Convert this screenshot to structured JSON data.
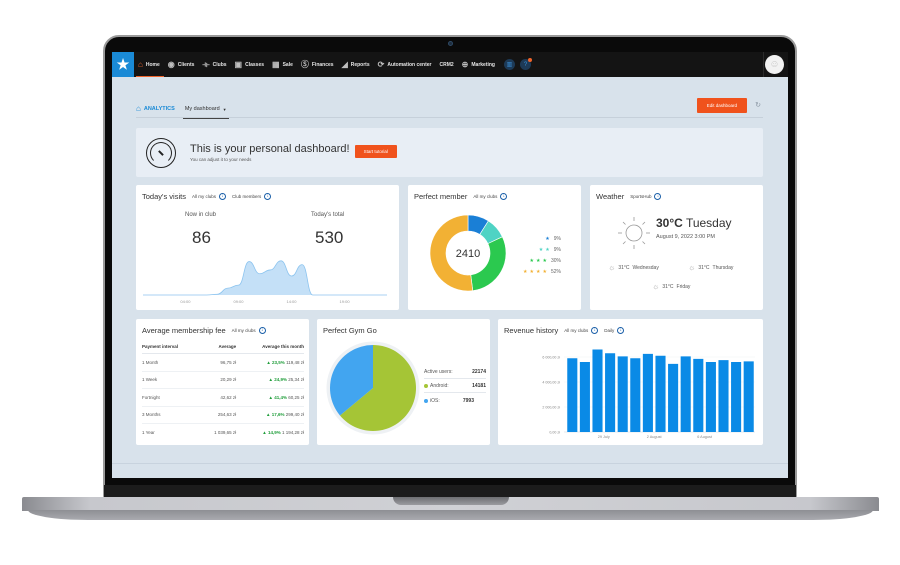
{
  "nav": {
    "logo": "logo-star",
    "items": [
      {
        "label": "Home",
        "icon": "home-icon",
        "glyph": "⌂",
        "active": true
      },
      {
        "label": "Clients",
        "icon": "user-circle-icon",
        "glyph": "◉"
      },
      {
        "label": "Clubs",
        "icon": "dumbbell-icon",
        "glyph": "⟛"
      },
      {
        "label": "Classes",
        "icon": "calendar-clock-icon",
        "glyph": "▣"
      },
      {
        "label": "Sale",
        "icon": "grid-icon",
        "glyph": "▦"
      },
      {
        "label": "Finances",
        "icon": "dollar-circle-icon",
        "glyph": "Ⓢ"
      },
      {
        "label": "Reports",
        "icon": "chart-icon",
        "glyph": "◢"
      },
      {
        "label": "Automation center",
        "icon": "sync-icon",
        "glyph": "⟳"
      },
      {
        "label": "CRM2",
        "icon": "",
        "glyph": ""
      },
      {
        "label": "Marketing",
        "icon": "target-icon",
        "glyph": "⊕"
      }
    ],
    "circle1_glyph": "▥",
    "circle2_glyph": "?",
    "avatar_glyph": "☺"
  },
  "header": {
    "section": "ANALYTICS",
    "dashboard_select": "My dashboard",
    "edit_button": "Edit dashboard"
  },
  "banner": {
    "title": "This is your personal dashboard!",
    "subtitle": "You can adjust it to your needs",
    "button": "Start tutorial"
  },
  "visits": {
    "title": "Today's visits",
    "filter1": "All my clubs",
    "filter2": "Club members",
    "now_label": "Now in club",
    "now_value": "86",
    "total_label": "Today's total",
    "total_value": "530",
    "x_labels": [
      "04:00",
      "09:00",
      "14:00",
      "19:00"
    ],
    "color": "#c4e0f7"
  },
  "member": {
    "title": "Perfect member",
    "filter": "All my clubs",
    "center_value": "2410",
    "segments": [
      {
        "stars": 1,
        "percent": 9,
        "label": "9%",
        "color": "#1a7fd6"
      },
      {
        "stars": 2,
        "percent": 9,
        "label": "9%",
        "color": "#4fd3c4"
      },
      {
        "stars": 3,
        "percent": 30,
        "label": "30%",
        "color": "#2bc94f"
      },
      {
        "stars": 4,
        "percent": 52,
        "label": "52%",
        "color": "#f2b134"
      }
    ]
  },
  "weather": {
    "title": "Weather",
    "filter": "SportsHub",
    "temp": "30°C",
    "day": "Tuesday",
    "date": "August 9, 2022 3:00 PM",
    "forecast": [
      {
        "temp": "31°C",
        "day": "Wednesday"
      },
      {
        "temp": "31°C",
        "day": "Thursday"
      },
      {
        "temp": "31°C",
        "day": "Friday"
      }
    ]
  },
  "fee": {
    "title": "Average membership fee",
    "filter": "All my clubs",
    "columns": [
      "Payment interval",
      "Average",
      "Average this month"
    ],
    "rows": [
      {
        "interval": "1 Month",
        "average": "96,75 zł",
        "change": "23,5%",
        "month": "119,48 zł"
      },
      {
        "interval": "1 Week",
        "average": "20,29 zł",
        "change": "24,9%",
        "month": "25,34 zł"
      },
      {
        "interval": "Fortnight",
        "average": "42,62 zł",
        "change": "41,4%",
        "month": "60,25 zł"
      },
      {
        "interval": "3 Months",
        "average": "254,63 zł",
        "change": "17,6%",
        "month": "299,40 zł"
      },
      {
        "interval": "1 Year",
        "average": "1 039,65 zł",
        "change": "14,9%",
        "month": "1 194,28 zł"
      }
    ]
  },
  "gym": {
    "title": "Perfect Gym Go",
    "active_label": "Active users:",
    "active_value": "22174",
    "android_label": "Android:",
    "android_value": "14181",
    "ios_label": "iOS:",
    "ios_value": "7993",
    "android_color": "#a5c536",
    "ios_color": "#42a5f0"
  },
  "revenue": {
    "title": "Revenue history",
    "filter1": "All my clubs",
    "filter2": "Daily"
  },
  "chart_data": [
    {
      "type": "area",
      "title": "Today's visits",
      "x": [
        "00:00",
        "01:00",
        "02:00",
        "03:00",
        "04:00",
        "05:00",
        "06:00",
        "07:00",
        "08:00",
        "09:00",
        "10:00",
        "11:00",
        "12:00",
        "13:00",
        "14:00",
        "15:00",
        "16:00",
        "17:00",
        "18:00",
        "19:00",
        "20:00",
        "21:00",
        "22:00",
        "23:00"
      ],
      "values": [
        0,
        0,
        0,
        0,
        0,
        0,
        0,
        1,
        9,
        13,
        44,
        28,
        33,
        45,
        25,
        40,
        0,
        0,
        0,
        0,
        0,
        0,
        0,
        0
      ],
      "x_tick_labels": [
        "04:00",
        "09:00",
        "14:00",
        "19:00"
      ],
      "ylim": [
        0,
        50
      ]
    },
    {
      "type": "pie",
      "title": "Perfect member",
      "center_label": "2410",
      "categories": [
        "1 star",
        "2 stars",
        "3 stars",
        "4 stars"
      ],
      "values": [
        9,
        9,
        30,
        52
      ]
    },
    {
      "type": "pie",
      "title": "Perfect Gym Go",
      "categories": [
        "Android",
        "iOS"
      ],
      "values": [
        14181,
        7993
      ]
    },
    {
      "type": "bar",
      "title": "Revenue history",
      "categories": [
        "d1",
        "d2",
        "d3",
        "d4",
        "d5",
        "d6",
        "d7",
        "d8",
        "d9",
        "d10",
        "d11",
        "d12",
        "d13",
        "d14",
        "d15"
      ],
      "values": [
        5900,
        5600,
        6600,
        6300,
        6050,
        5900,
        6250,
        6100,
        5450,
        6050,
        5850,
        5600,
        5750,
        5600,
        5650
      ],
      "y_tick_labels": [
        "0,00 zł",
        "2 000,00 zł",
        "4 000,00 zł",
        "6 000,00 zł"
      ],
      "x_tick_labels": [
        "29 July",
        "2 August",
        "6 August"
      ],
      "ylim": [
        0,
        6800
      ],
      "color": "#0a8ae6"
    }
  ]
}
